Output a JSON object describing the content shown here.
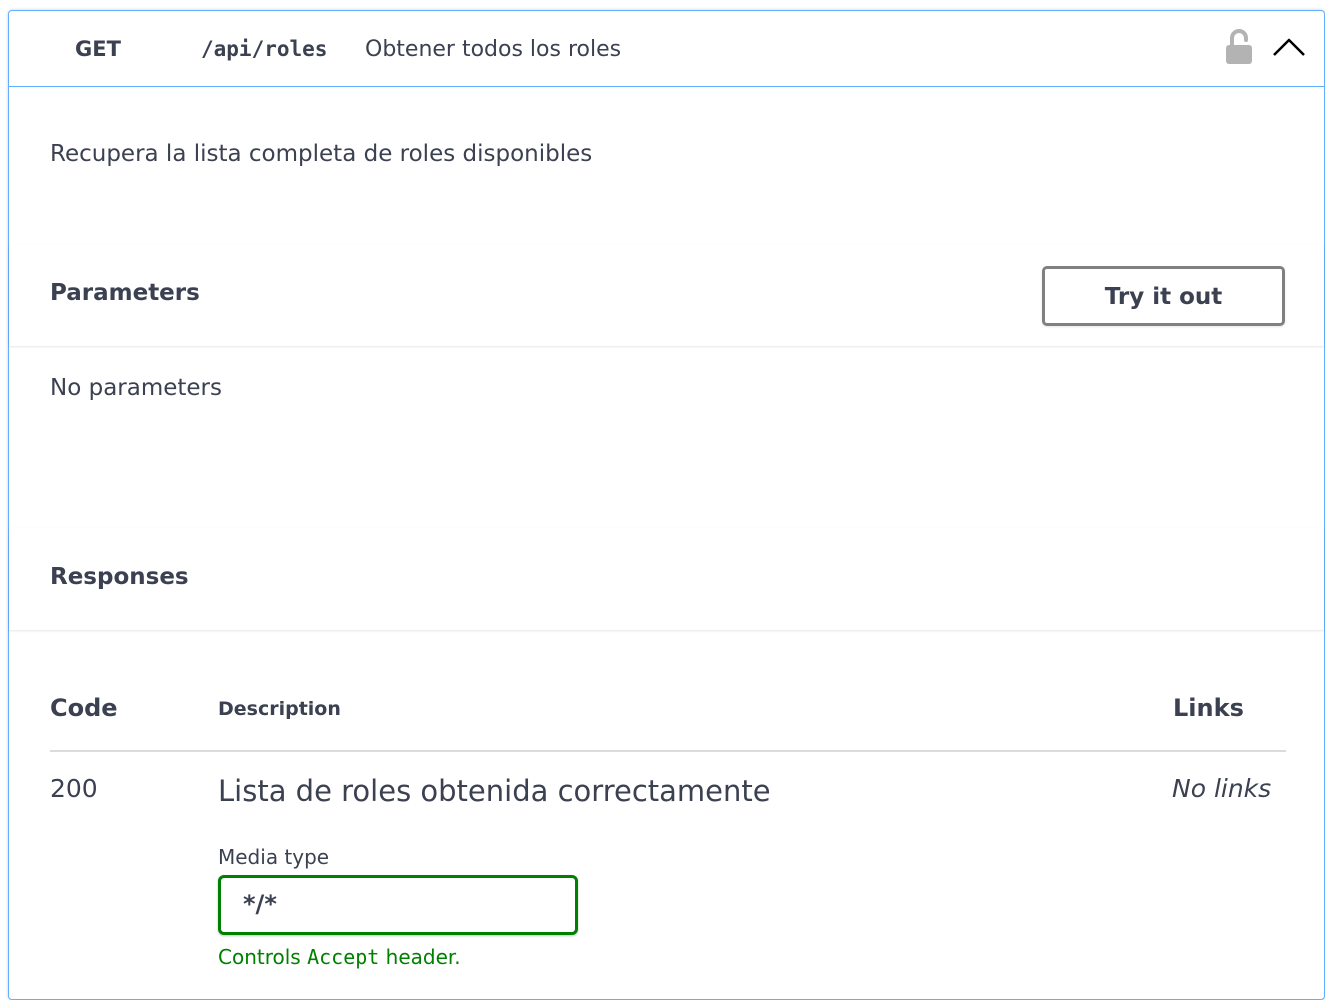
{
  "operation": {
    "method": "GET",
    "path": "/api/roles",
    "summary": "Obtener todos los roles",
    "description": "Recupera la lista completa de roles disponibles",
    "icons": {
      "lock": "unlocked-lock-icon",
      "collapse": "chevron-up-icon"
    },
    "method_color": "#61affe"
  },
  "parameters": {
    "title": "Parameters",
    "try_button": "Try it out",
    "empty_text": "No parameters"
  },
  "responses": {
    "title": "Responses",
    "columns": {
      "code": "Code",
      "description": "Description",
      "links": "Links"
    },
    "rows": [
      {
        "code": "200",
        "description": "Lista de roles obtenida correctamente",
        "links": "No links",
        "media_type_label": "Media type",
        "media_type_value": "*/*",
        "hint_prefix": "Controls ",
        "hint_code": "Accept",
        "hint_suffix": " header."
      }
    ]
  }
}
